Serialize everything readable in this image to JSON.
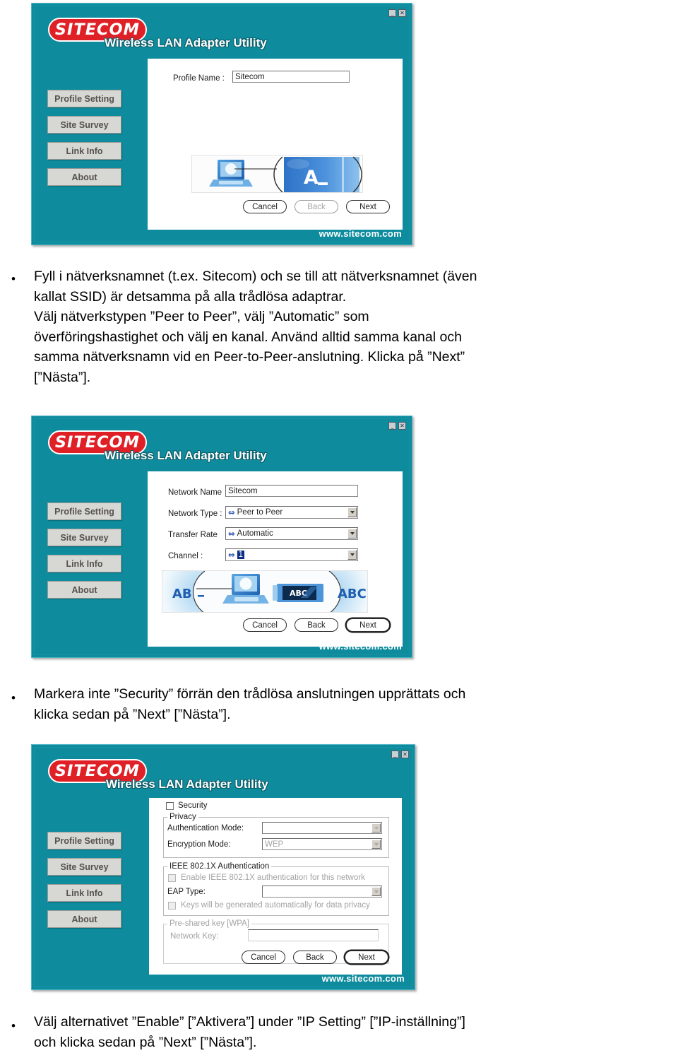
{
  "document": {
    "brand": "SITECOM",
    "app_title": "Wireless LAN Adapter Utility",
    "footer_url": "www.sitecom.com",
    "caption_minimize": "_",
    "caption_close": "✕",
    "sidebar": [
      "Profile Setting",
      "Site Survey",
      "Link Info",
      "About"
    ]
  },
  "colors": {
    "window_teal": "#0e8c9e",
    "window_border": "#4fb6c4",
    "logo_red": "#e02027",
    "sidebar_button": "#d7d7d4",
    "panel_white": "#ffffff",
    "selection_blue": "#0b2e84"
  },
  "dialog1": {
    "form": {
      "profile_name_label": "Profile Name :",
      "profile_name_value": "Sitecom"
    },
    "illustration": {
      "node_label": "A_",
      "device": "laptop-icon"
    },
    "buttons": [
      {
        "label": "Cancel",
        "accel": "C",
        "state": "enabled"
      },
      {
        "label": "Back",
        "accel": "B",
        "state": "disabled"
      },
      {
        "label": "Next",
        "accel": "N",
        "state": "enabled"
      }
    ]
  },
  "text1": {
    "lines": [
      "Fyll i nätverksnamnet (t.ex. Sitecom) och se till att nätverksnamnet (även",
      "kallat SSID) är detsamma på alla trådlösa adaptrar.",
      "Välj nätverkstypen ”Peer to Peer”, välj ”Automatic” som",
      "överföringshastighet och välj en kanal. Använd alltid samma kanal och",
      "samma nätverksnamn vid en Peer-to-Peer-anslutning. Klicka på ”Next”",
      "[”Nästa”]."
    ]
  },
  "dialog2": {
    "form": {
      "network_name_label": "Network Name",
      "network_name_value": "Sitecom",
      "network_type_label": "Network Type :",
      "network_type_value": "Peer to Peer",
      "transfer_rate_label": "Transfer Rate",
      "transfer_rate_value": "Automatic",
      "channel_label": "Channel :",
      "channel_value": "1"
    },
    "illustration": {
      "left_label": "AB",
      "mid_label": "ABC",
      "right_label": "ABC"
    },
    "buttons": [
      {
        "label": "Cancel",
        "accel": "C",
        "state": "enabled"
      },
      {
        "label": "Back",
        "accel": "B",
        "state": "enabled"
      },
      {
        "label": "Next",
        "accel": "N",
        "state": "default"
      }
    ]
  },
  "text2": {
    "lines": [
      "Markera inte ”Security” förrän den trådlösa anslutningen upprättats och",
      "klicka sedan på ”Next” [”Nästa”]."
    ]
  },
  "dialog3": {
    "form": {
      "security_checkbox_label": "Security",
      "privacy_group": "Privacy",
      "auth_mode_label": "Authentication Mode:",
      "auth_mode_value": "",
      "encryption_mode_label": "Encryption Mode:",
      "encryption_mode_value": "WEP",
      "ieee_group": "IEEE 802.1X Authentication",
      "enable_ieee_label": "Enable IEEE 802.1X authentication for this network",
      "eap_type_label": "EAP Type:",
      "eap_type_value": "",
      "keys_auto_label": "Keys will be generated automatically for data privacy",
      "psk_group": "Pre-shared key [WPA]",
      "network_key_label": "Network Key:",
      "network_key_value": ""
    },
    "buttons": [
      {
        "label": "Cancel",
        "accel": "",
        "state": "enabled"
      },
      {
        "label": "Back",
        "accel": "",
        "state": "enabled"
      },
      {
        "label": "Next",
        "accel": "",
        "state": "default"
      }
    ]
  },
  "text3": {
    "lines": [
      "Välj alternativet ”Enable” [”Aktivera”] under ”IP Setting” [”IP-inställning”]",
      "och klicka sedan på ”Next” [”Nästa”]."
    ]
  }
}
